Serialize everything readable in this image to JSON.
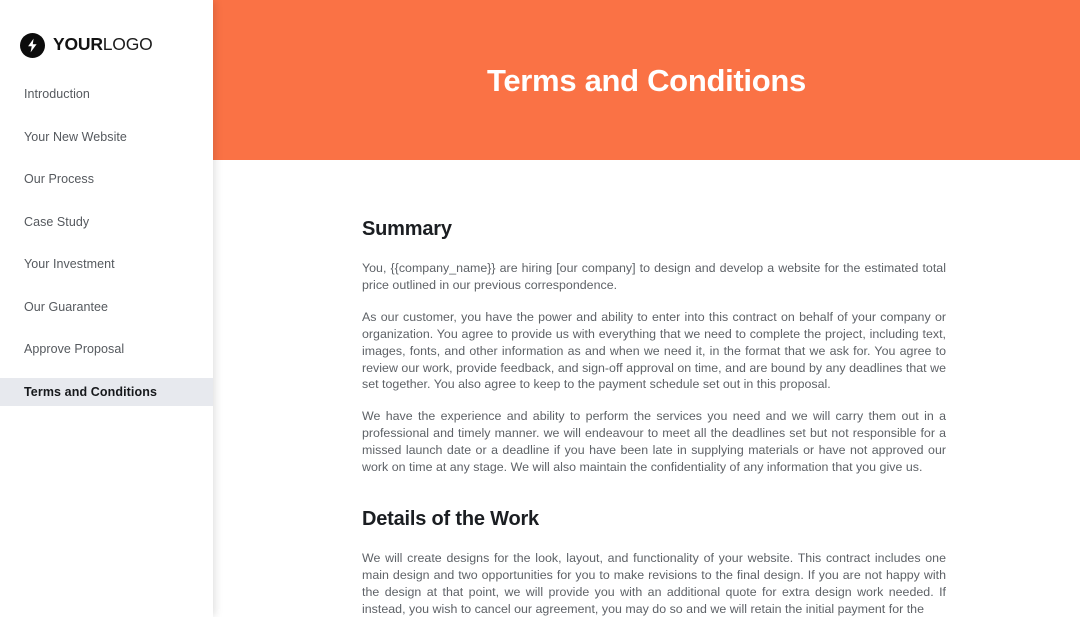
{
  "brand": {
    "icon": "lightning-bolt-icon",
    "name_strong": "YOUR",
    "name_light": "LOGO"
  },
  "sidebar": {
    "items": [
      {
        "label": "Introduction",
        "active": false
      },
      {
        "label": "Your New Website",
        "active": false
      },
      {
        "label": "Our Process",
        "active": false
      },
      {
        "label": "Case Study",
        "active": false
      },
      {
        "label": "Your Investment",
        "active": false
      },
      {
        "label": "Our Guarantee",
        "active": false
      },
      {
        "label": "Approve Proposal",
        "active": false
      },
      {
        "label": "Terms and Conditions",
        "active": true
      }
    ]
  },
  "banner": {
    "title": "Terms and Conditions",
    "background_color": "#FA7245",
    "text_color": "#FFFFFF"
  },
  "document": {
    "sections": [
      {
        "heading": "Summary",
        "paragraphs": [
          "You, {{company_name}} are hiring [our company] to design and develop a website for the estimated total price outlined in our previous correspondence.",
          "As our customer, you have the power and ability to enter into this contract on behalf of your company or organization. You agree to provide us with everything that we need to complete the project, including text, images, fonts, and other information as and when we need it, in the format that we ask for. You agree to review our work, provide feedback, and sign-off approval on time, and are bound by any deadlines that we set together. You also agree to keep to the payment schedule set out in this proposal.",
          "We have the experience and ability to perform the services you need and we will carry them out in a professional and timely manner. we will endeavour to meet all the deadlines set but not responsible for a missed launch date or a deadline if you have been late in supplying materials or have not approved our work on time at any stage. We will also maintain the confidentiality of any information that you give us."
        ]
      },
      {
        "heading": "Details of the Work",
        "paragraphs": [
          "We will create designs for the look, layout, and functionality of your website. This contract includes one main design and two opportunities for you to make revisions to the final design. If you are not happy with the design at that point, we will provide you with an additional quote for extra design work needed. If instead, you wish to cancel our agreement, you may do so and we will retain the initial payment for the"
        ]
      }
    ]
  },
  "colors": {
    "accent": "#FA7245",
    "sidebar_active_bg": "#E7E9EE",
    "heading": "#1B1E22",
    "body_text": "#5E6267",
    "nav_text": "#55595E"
  }
}
